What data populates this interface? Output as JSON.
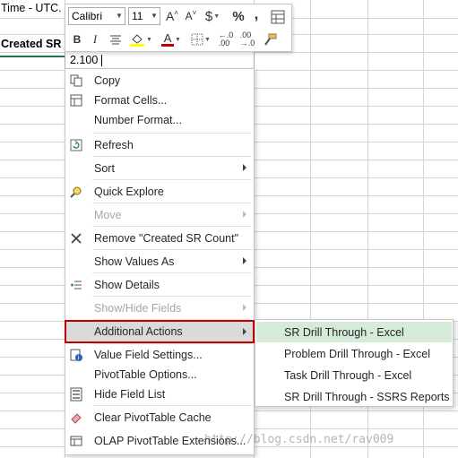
{
  "sheet": {
    "cells": {
      "time_header": "Time - UTC.",
      "created_header": "Created SR",
      "active_value": "2.100"
    }
  },
  "mini_toolbar": {
    "font_name": "Calibri",
    "font_size": "11",
    "grow_font": "A",
    "shrink_font": "A",
    "currency": "$",
    "percent": "%",
    "comma": ",",
    "bold": "B",
    "italic": "I",
    "font_color_letter": "A",
    "colors": {
      "highlight": "#ffff00",
      "font": "#c00000"
    }
  },
  "context_menu": {
    "items": [
      {
        "label": "Copy",
        "icon": "copy-icon",
        "enabled": true
      },
      {
        "label": "Format Cells...",
        "icon": "format-cells-icon",
        "enabled": true
      },
      {
        "label": "Number Format...",
        "icon": "",
        "enabled": true
      },
      {
        "label": "Refresh",
        "icon": "refresh-icon",
        "enabled": true
      },
      {
        "label": "Sort",
        "icon": "",
        "enabled": true,
        "submenu": true
      },
      {
        "label": "Quick Explore",
        "icon": "quick-explore-icon",
        "enabled": true
      },
      {
        "label": "Move",
        "icon": "",
        "enabled": false,
        "submenu": true
      },
      {
        "label": "Remove \"Created SR Count\"",
        "icon": "remove-icon",
        "enabled": true
      },
      {
        "label": "Show Values As",
        "icon": "",
        "enabled": true,
        "submenu": true
      },
      {
        "label": "Show Details",
        "icon": "show-details-icon",
        "enabled": true
      },
      {
        "label": "Show/Hide Fields",
        "icon": "",
        "enabled": false,
        "submenu": true
      },
      {
        "label": "Additional Actions",
        "icon": "",
        "enabled": true,
        "submenu": true,
        "highlighted": true
      },
      {
        "label": "Value Field Settings...",
        "icon": "value-field-settings-icon",
        "enabled": true
      },
      {
        "label": "PivotTable Options...",
        "icon": "",
        "enabled": true
      },
      {
        "label": "Hide Field List",
        "icon": "field-list-icon",
        "enabled": true
      },
      {
        "label": "Clear PivotTable Cache",
        "icon": "eraser-icon",
        "enabled": true
      },
      {
        "label": "OLAP PivotTable Extensions...",
        "icon": "olap-extensions-icon",
        "enabled": true
      }
    ]
  },
  "submenu": {
    "items": [
      {
        "label": "SR Drill Through - Excel",
        "hover": true
      },
      {
        "label": "Problem Drill Through - Excel"
      },
      {
        "label": "Task Drill Through - Excel"
      },
      {
        "label": "SR Drill Through - SSRS Reports"
      }
    ]
  },
  "watermark": "http://blog.csdn.net/rav009"
}
